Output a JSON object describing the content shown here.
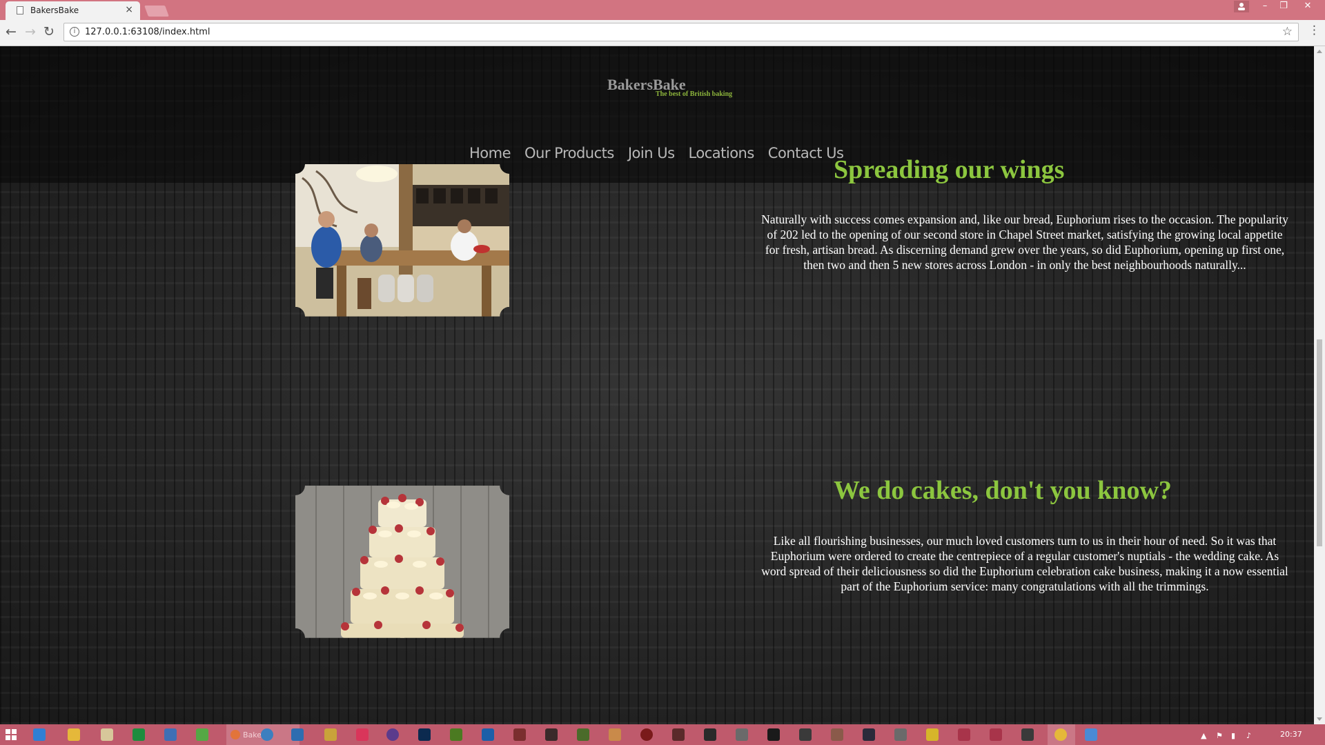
{
  "browser": {
    "tab_title": "BakersBake",
    "tab_close": "×",
    "url": "127.0.0.1:63108/index.html",
    "window_controls": {
      "minimize": "–",
      "restore": "❐",
      "close": "✕"
    },
    "back_icon": "←",
    "forward_icon": "→",
    "reload_icon": "↻",
    "info_icon": "i",
    "star_icon": "☆",
    "menu_icon": "⋮"
  },
  "site": {
    "logo": "BakersBake",
    "tagline": "The best of British baking",
    "nav": [
      "Home",
      "Our Products",
      "Join Us",
      "Locations",
      "Contact Us"
    ]
  },
  "sections": [
    {
      "title": "Spreading our wings",
      "text": "Naturally with success comes expansion and, like our bread, Euphorium rises to the occasion. The popularity of 202 led to the opening of our second store in Chapel Street market, satisfying the growing local appetite for fresh, artisan bread. As discerning demand grew over the years, so did Euphorium, opening up first one, then two and then 5 new stores across London - in only the best neighbourhoods naturally..."
    },
    {
      "title": "We do cakes, don't you know?",
      "text": "Like all flourishing businesses, our much loved customers turn to us in their hour of need. So it was that Euphorium were ordered to create the centrepiece of a regular customer's nuptials - the wedding cake. As word spread of their deliciousness so did the Euphorium celebration cake business, making it a now essential part of the Euphorium service: many congratulations with all the trimmings."
    }
  ],
  "taskbar": {
    "clock": "20:37",
    "chrome_item_label": "Bakers"
  },
  "colors": {
    "accent_green": "#8cc63f",
    "tab_strip": "#d27481",
    "taskbar": "#bf5a6c"
  }
}
